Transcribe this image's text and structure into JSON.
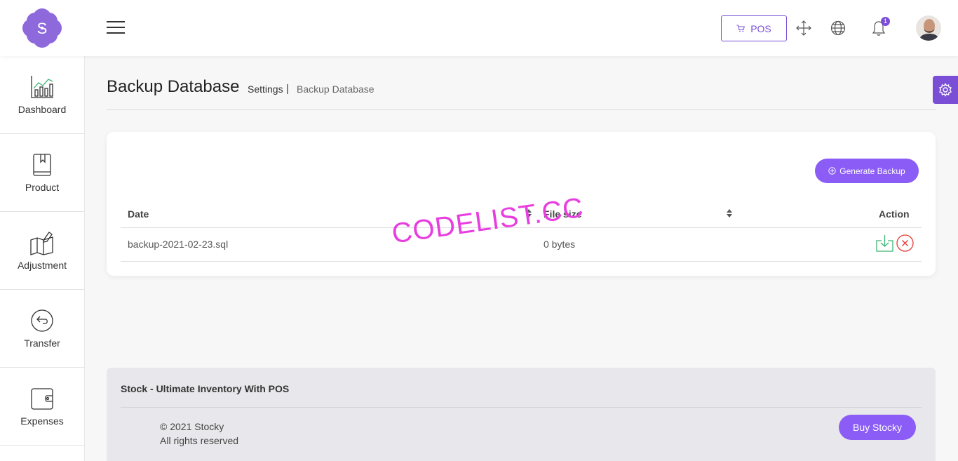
{
  "header": {
    "logo_letter": "S",
    "pos_label": "POS",
    "notification_count": "1"
  },
  "sidebar": {
    "items": [
      {
        "label": "Dashboard",
        "icon": "chart-icon"
      },
      {
        "label": "Product",
        "icon": "book-icon"
      },
      {
        "label": "Adjustment",
        "icon": "map-edit-icon"
      },
      {
        "label": "Transfer",
        "icon": "return-arrow-icon"
      },
      {
        "label": "Expenses",
        "icon": "wallet-icon"
      }
    ]
  },
  "breadcrumb": {
    "title": "Backup Database",
    "parent": "Settings",
    "separator": "|",
    "current": "Backup Database"
  },
  "card": {
    "generate_label": "Generate Backup",
    "columns": [
      "Date",
      "File size",
      "Action"
    ],
    "rows": [
      {
        "date": "backup-2021-02-23.sql",
        "size": "0 bytes"
      }
    ]
  },
  "watermark": "CODELIST.CC",
  "footer": {
    "title": "Stock - Ultimate Inventory With POS",
    "copyright": "© 2021 Stocky",
    "rights": "All rights reserved",
    "buy_label": "Buy Stocky"
  },
  "colors": {
    "accent": "#8b5cf6",
    "accent_dark": "#7a4fd6",
    "download": "#3cb371",
    "delete": "#e53935"
  }
}
